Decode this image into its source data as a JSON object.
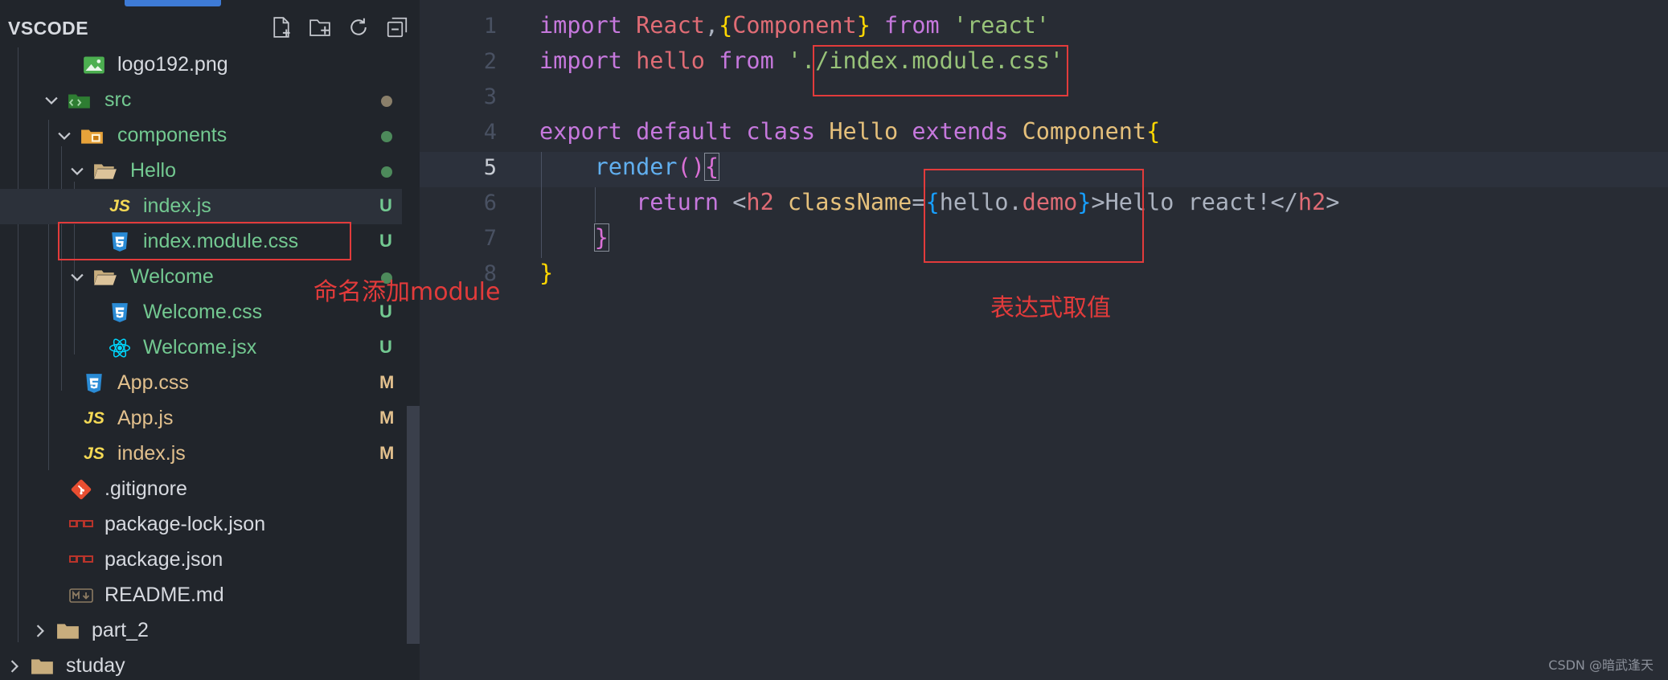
{
  "sidebar": {
    "title": "VSCODE",
    "actions": [
      "new-file-icon",
      "new-folder-icon",
      "refresh-icon",
      "collapse-all-icon"
    ],
    "items": [
      {
        "label": "logo192.png",
        "icon": "image-icon",
        "status": ""
      },
      {
        "label": "src",
        "icon": "src-folder-icon",
        "status": "dot",
        "expanded": true
      },
      {
        "label": "components",
        "icon": "components-folder-icon",
        "status": "dot",
        "expanded": true
      },
      {
        "label": "Hello",
        "icon": "folder-open-icon",
        "status": "dot",
        "expanded": true
      },
      {
        "label": "index.js",
        "icon": "js-icon",
        "status": "U",
        "selected": true
      },
      {
        "label": "index.module.css",
        "icon": "css-icon",
        "status": "U"
      },
      {
        "label": "Welcome",
        "icon": "folder-open-icon",
        "status": "dot",
        "expanded": true
      },
      {
        "label": "Welcome.css",
        "icon": "css-icon",
        "status": "U"
      },
      {
        "label": "Welcome.jsx",
        "icon": "react-icon",
        "status": "U"
      },
      {
        "label": "App.css",
        "icon": "css-icon",
        "status": "M"
      },
      {
        "label": "App.js",
        "icon": "js-icon",
        "status": "M"
      },
      {
        "label": "index.js",
        "icon": "js-icon",
        "status": "M"
      },
      {
        "label": ".gitignore",
        "icon": "git-icon",
        "status": ""
      },
      {
        "label": "package-lock.json",
        "icon": "npm-icon",
        "status": ""
      },
      {
        "label": "package.json",
        "icon": "npm-icon",
        "status": ""
      },
      {
        "label": "README.md",
        "icon": "markdown-icon",
        "status": ""
      },
      {
        "label": "part_2",
        "icon": "folder-icon",
        "status": "",
        "expanded": false
      },
      {
        "label": "studay",
        "icon": "folder-icon",
        "status": "",
        "expanded": false
      }
    ],
    "icon_text": {
      "js": "JS"
    }
  },
  "editor": {
    "line_numbers": [
      "1",
      "2",
      "3",
      "4",
      "5",
      "6",
      "7",
      "8"
    ],
    "active_line": "5",
    "tokens": {
      "l1": {
        "import": "import",
        "react": "React",
        "comma": ",",
        "lb": "{",
        "component": "Component",
        "rb": "}",
        "from": "from",
        "str": "'react'"
      },
      "l2": {
        "import": "import",
        "hello": "hello",
        "from": "from",
        "q1": "'",
        "path": "./index.module.css'"
      },
      "l4": {
        "export": "export",
        "default": "default",
        "class": "class",
        "name": "Hello",
        "extends": "extends",
        "base": "Component",
        "lb": "{"
      },
      "l5": {
        "render": "render",
        "parens": "()",
        "lb": "{"
      },
      "l6": {
        "return": "return",
        "lt": "<",
        "h2": "h2",
        "attr": "className",
        "eq": "=",
        "lb": "{",
        "obj": "hello",
        "dot": ".",
        "prop": "demo",
        "rb": "}",
        "gt": ">",
        "text": "Hello react!",
        "close_lt": "</",
        "close_h2": "h2",
        "close_gt": ">"
      },
      "l7": {
        "rb": "}"
      },
      "l8": {
        "rb": "}"
      }
    }
  },
  "annotations": {
    "naming": "命名添加module",
    "expression": "表达式取值"
  },
  "watermark": "CSDN @暗武逢天",
  "colors": {
    "annotation": "#e23b3b",
    "untracked": "#73c991",
    "modified": "#e2c08d"
  }
}
